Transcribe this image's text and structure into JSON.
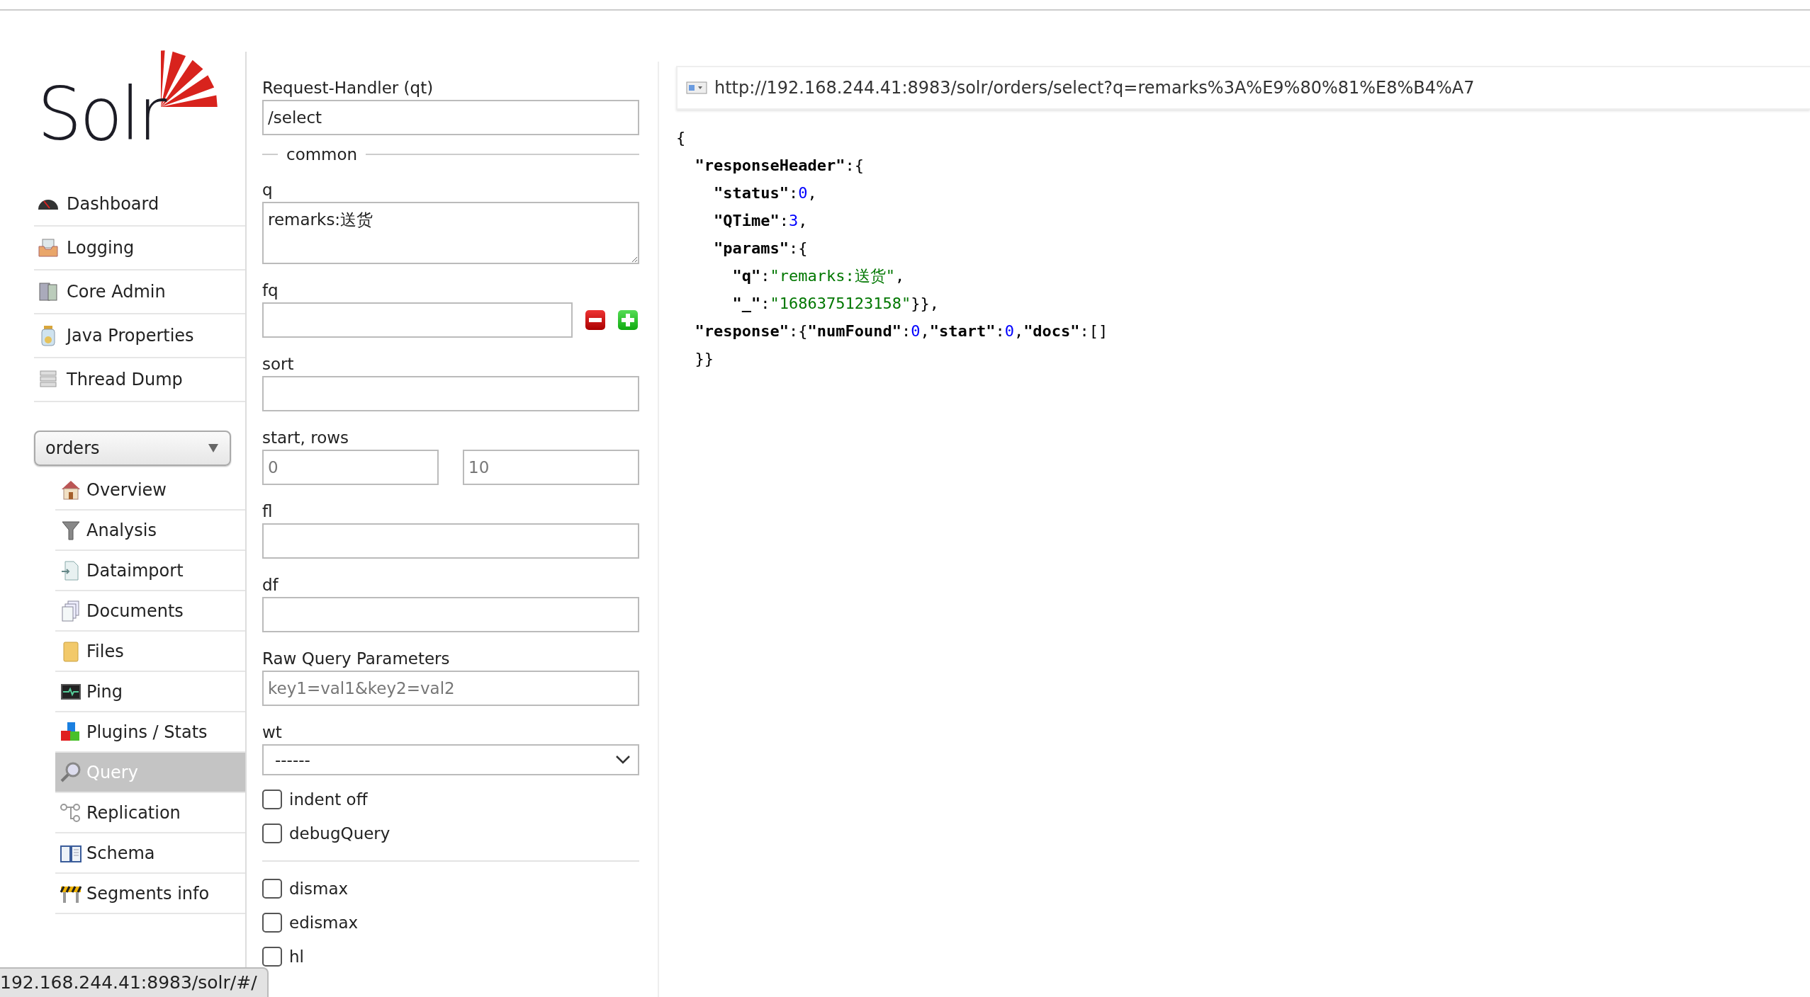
{
  "logo": {
    "text": "Solr"
  },
  "nav": [
    {
      "label": "Dashboard",
      "selected": false
    },
    {
      "label": "Logging",
      "selected": false
    },
    {
      "label": "Core Admin",
      "selected": false
    },
    {
      "label": "Java Properties",
      "selected": false
    },
    {
      "label": "Thread Dump",
      "selected": false
    }
  ],
  "core_selector": {
    "value": "orders"
  },
  "core_menu": [
    {
      "label": "Overview",
      "selected": false
    },
    {
      "label": "Analysis",
      "selected": false
    },
    {
      "label": "Dataimport",
      "selected": false
    },
    {
      "label": "Documents",
      "selected": false
    },
    {
      "label": "Files",
      "selected": false
    },
    {
      "label": "Ping",
      "selected": false
    },
    {
      "label": "Plugins / Stats",
      "selected": false
    },
    {
      "label": "Query",
      "selected": true
    },
    {
      "label": "Replication",
      "selected": false
    },
    {
      "label": "Schema",
      "selected": false
    },
    {
      "label": "Segments info",
      "selected": false
    }
  ],
  "form": {
    "handler": {
      "label": "Request-Handler (qt)",
      "value": "/select"
    },
    "legend": "common",
    "fields": [
      {
        "kind": "textarea",
        "label": "q",
        "value": "remarks:送货"
      },
      {
        "kind": "filter",
        "label": "fq"
      },
      {
        "kind": "text",
        "label": "sort"
      },
      {
        "kind": "pair",
        "label": "start, rows",
        "placeholders": [
          "0",
          "10"
        ]
      },
      {
        "kind": "text",
        "label": "fl"
      },
      {
        "kind": "text",
        "label": "df"
      },
      {
        "kind": "text",
        "label": "Raw Query Parameters",
        "placeholder": "key1=val1&key2=val2"
      },
      {
        "kind": "select",
        "label": "wt",
        "value": "------"
      }
    ],
    "options": [
      {
        "label": "indent off",
        "checked": false
      },
      {
        "label": "debugQuery",
        "checked": false
      }
    ],
    "parsers": [
      {
        "label": "dismax",
        "checked": false
      },
      {
        "label": "edismax",
        "checked": false
      },
      {
        "label": "hl",
        "checked": false
      }
    ]
  },
  "result": {
    "url": "http://192.168.244.41:8983/solr/orders/select?q=remarks%3A%E9%80%81%E8%B4%A7",
    "lines": [
      [
        {
          "kind": "punct",
          "text": "{"
        }
      ],
      [
        {
          "kind": "key",
          "text": "  \"responseHeader\""
        },
        {
          "kind": "punct",
          "text": ":{"
        }
      ],
      [
        {
          "kind": "key",
          "text": "    \"status\""
        },
        {
          "kind": "punct",
          "text": ":"
        },
        {
          "kind": "number",
          "text": "0"
        },
        {
          "kind": "punct",
          "text": ","
        }
      ],
      [
        {
          "kind": "key",
          "text": "    \"QTime\""
        },
        {
          "kind": "punct",
          "text": ":"
        },
        {
          "kind": "number",
          "text": "3"
        },
        {
          "kind": "punct",
          "text": ","
        }
      ],
      [
        {
          "kind": "key",
          "text": "    \"params\""
        },
        {
          "kind": "punct",
          "text": ":{"
        }
      ],
      [
        {
          "kind": "key",
          "text": "      \"q\""
        },
        {
          "kind": "punct",
          "text": ":"
        },
        {
          "kind": "string",
          "text": "\"remarks:送货\""
        },
        {
          "kind": "punct",
          "text": ","
        }
      ],
      [
        {
          "kind": "key",
          "text": "      \"_\""
        },
        {
          "kind": "punct",
          "text": ":"
        },
        {
          "kind": "string",
          "text": "\"1686375123158\""
        },
        {
          "kind": "punct",
          "text": "}},"
        }
      ],
      [
        {
          "kind": "key",
          "text": "  \"response\""
        },
        {
          "kind": "punct",
          "text": ":{"
        },
        {
          "kind": "key",
          "text": "\"numFound\""
        },
        {
          "kind": "punct",
          "text": ":"
        },
        {
          "kind": "number",
          "text": "0"
        },
        {
          "kind": "punct",
          "text": ","
        },
        {
          "kind": "key",
          "text": "\"start\""
        },
        {
          "kind": "punct",
          "text": ":"
        },
        {
          "kind": "number",
          "text": "0"
        },
        {
          "kind": "punct",
          "text": ","
        },
        {
          "kind": "key",
          "text": "\"docs\""
        },
        {
          "kind": "punct",
          "text": ":[]"
        }
      ],
      [
        {
          "kind": "punct",
          "text": "  }}"
        }
      ]
    ]
  },
  "status_bar": {
    "text": "192.168.244.41:8983/solr/#/"
  }
}
